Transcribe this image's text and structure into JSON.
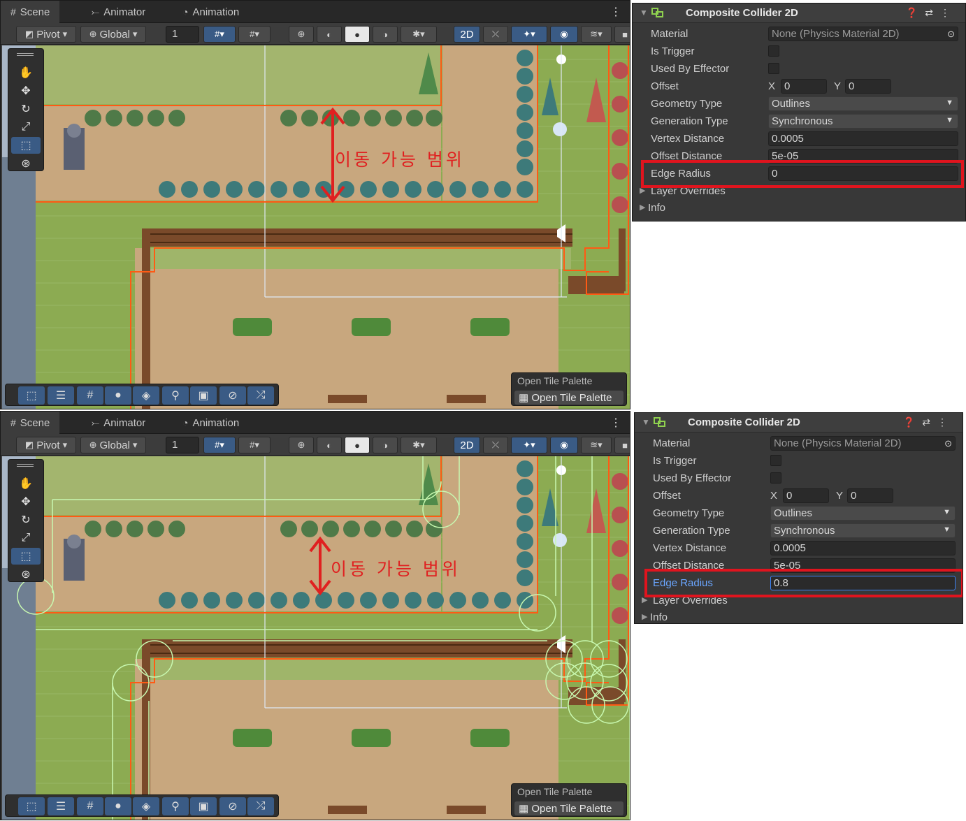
{
  "tabs": {
    "scene": "Scene",
    "animator": "Animator",
    "animation": "Animation"
  },
  "toolbar": {
    "pivot": "Pivot",
    "global": "Global",
    "grid_value": "1",
    "mode_2d": "2D"
  },
  "tile_palette": {
    "title": "Open Tile Palette",
    "button": "Open Tile Palette"
  },
  "annotation": {
    "movable_range": "이동 가능 범위"
  },
  "colors": {
    "annotation": "#e02020",
    "collider_outline": "#ff5a14",
    "edge_radius_outline": "#b8f5a0",
    "highlight_box": "#e0141e",
    "focus_blue": "#3b82f6"
  },
  "inspector_top": {
    "title": "Composite Collider 2D",
    "material_label": "Material",
    "material_value": "None (Physics Material 2D)",
    "is_trigger_label": "Is Trigger",
    "used_by_effector_label": "Used By Effector",
    "offset_label": "Offset",
    "offset_x_label": "X",
    "offset_x": "0",
    "offset_y_label": "Y",
    "offset_y": "0",
    "geometry_type_label": "Geometry Type",
    "geometry_type": "Outlines",
    "generation_type_label": "Generation Type",
    "generation_type": "Synchronous",
    "vertex_distance_label": "Vertex Distance",
    "vertex_distance": "0.0005",
    "offset_distance_label": "Offset Distance",
    "offset_distance": "5e-05",
    "edge_radius_label": "Edge Radius",
    "edge_radius": "0",
    "layer_overrides_label": "Layer Overrides",
    "info_label": "Info"
  },
  "inspector_bottom": {
    "title": "Composite Collider 2D",
    "material_label": "Material",
    "material_value": "None (Physics Material 2D)",
    "is_trigger_label": "Is Trigger",
    "used_by_effector_label": "Used By Effector",
    "offset_label": "Offset",
    "offset_x_label": "X",
    "offset_x": "0",
    "offset_y_label": "Y",
    "offset_y": "0",
    "geometry_type_label": "Geometry Type",
    "geometry_type": "Outlines",
    "generation_type_label": "Generation Type",
    "generation_type": "Synchronous",
    "vertex_distance_label": "Vertex Distance",
    "vertex_distance": "0.0005",
    "offset_distance_label": "Offset Distance",
    "offset_distance": "5e-05",
    "edge_radius_label": "Edge Radius",
    "edge_radius": "0.8",
    "layer_overrides_label": "Layer Overrides",
    "info_label": "Info"
  }
}
